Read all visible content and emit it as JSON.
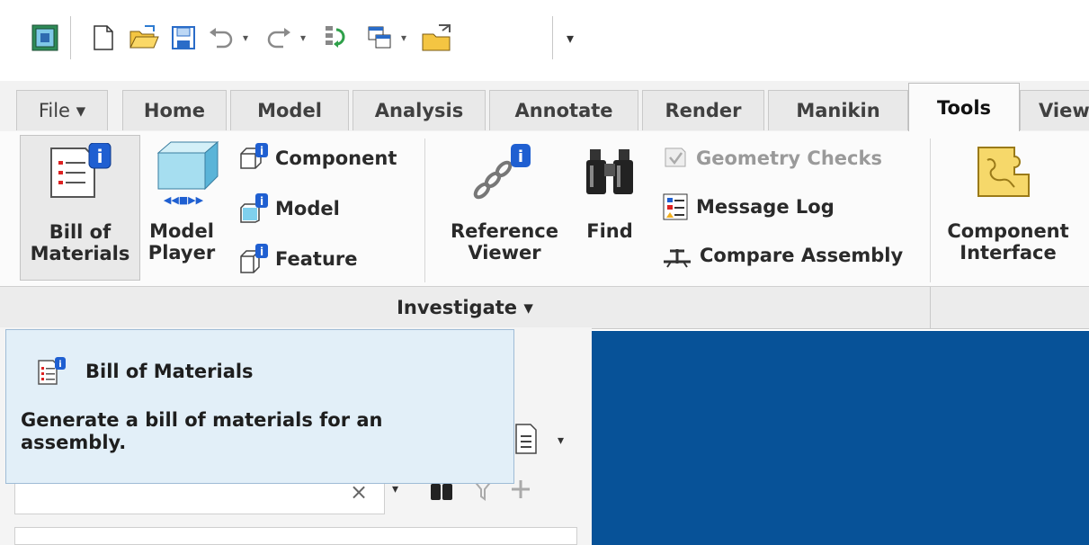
{
  "tabs": [
    {
      "label": "File ▾"
    },
    {
      "label": "Home"
    },
    {
      "label": "Model"
    },
    {
      "label": "Analysis"
    },
    {
      "label": "Annotate"
    },
    {
      "label": "Render"
    },
    {
      "label": "Manikin"
    },
    {
      "label": "Tools"
    },
    {
      "label": "View"
    }
  ],
  "active_tab": "Tools",
  "ribbon": {
    "bom": {
      "line1": "Bill of",
      "line2": "Materials"
    },
    "model_player": {
      "line1": "Model",
      "line2": "Player"
    },
    "info": {
      "component": "Component",
      "model": "Model",
      "feature": "Feature"
    },
    "reference_viewer": {
      "line1": "Reference",
      "line2": "Viewer"
    },
    "find": "Find",
    "geometry_checks": "Geometry Checks",
    "message_log": "Message Log",
    "compare_assembly": "Compare Assembly",
    "component_interface": {
      "line1": "Component",
      "line2": "Interface"
    },
    "group_label": "Investigate ▾"
  },
  "tooltip": {
    "title": "Bill of Materials",
    "description": "Generate a bill of materials for an assembly."
  },
  "lower": {
    "search_clear": "×"
  },
  "colors": {
    "graphics_bg": "#075298",
    "tooltip_bg": "#e2eff8",
    "accent_blue": "#1f5fd1"
  }
}
